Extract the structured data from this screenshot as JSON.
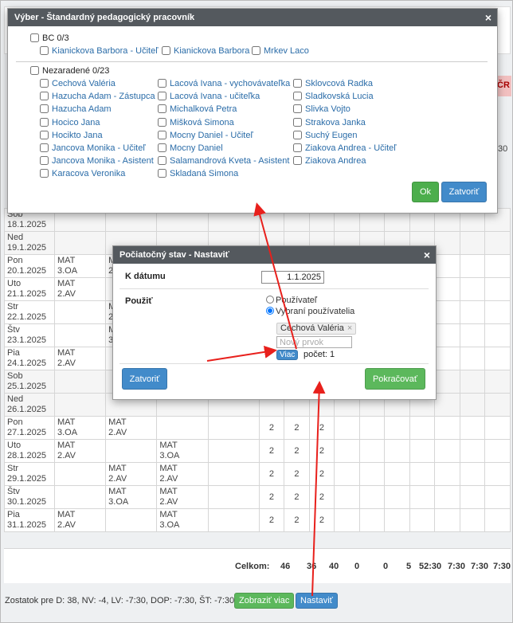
{
  "background": {
    "cr_badge": "ČR",
    "time_tail": ":30",
    "rows": [
      {
        "day": "Sob",
        "date": "18.1.2025",
        "c1": "",
        "c2": "",
        "c3": "",
        "n1": "",
        "n2": "",
        "n3": "",
        "we": true
      },
      {
        "day": "Ned",
        "date": "19.1.2025",
        "c1": "",
        "c2": "",
        "c3": "",
        "n1": "",
        "n2": "",
        "n3": "",
        "we": true
      },
      {
        "day": "Pon",
        "date": "20.1.2025",
        "c1": "MAT\n3.OA",
        "c2": "MAT\n2.AV",
        "c3": "",
        "n1": "",
        "n2": "",
        "n3": "",
        "we": false
      },
      {
        "day": "Uto",
        "date": "21.1.2025",
        "c1": "MAT\n2.AV",
        "c2": "",
        "c3": "",
        "n1": "",
        "n2": "",
        "n3": "",
        "we": false
      },
      {
        "day": "Str",
        "date": "22.1.2025",
        "c1": "",
        "c2": "MAT\n2.AV",
        "c3": "",
        "n1": "",
        "n2": "",
        "n3": "",
        "we": false
      },
      {
        "day": "Štv",
        "date": "23.1.2025",
        "c1": "",
        "c2": "MAT\n3.OA",
        "c3": "",
        "n1": "",
        "n2": "",
        "n3": "",
        "we": false
      },
      {
        "day": "Pia",
        "date": "24.1.2025",
        "c1": "MAT\n2.AV",
        "c2": "",
        "c3": "",
        "n1": "",
        "n2": "",
        "n3": "",
        "we": false
      },
      {
        "day": "Sob",
        "date": "25.1.2025",
        "c1": "",
        "c2": "",
        "c3": "",
        "n1": "",
        "n2": "",
        "n3": "",
        "we": true
      },
      {
        "day": "Ned",
        "date": "26.1.2025",
        "c1": "",
        "c2": "",
        "c3": "",
        "n1": "",
        "n2": "",
        "n3": "",
        "we": true
      },
      {
        "day": "Pon",
        "date": "27.1.2025",
        "c1": "MAT\n3.OA",
        "c2": "MAT\n2.AV",
        "c3": "",
        "n1": "2",
        "n2": "2",
        "n3": "2",
        "we": false
      },
      {
        "day": "Uto",
        "date": "28.1.2025",
        "c1": "MAT\n2.AV",
        "c2": "",
        "c3": "MAT\n3.OA",
        "n1": "2",
        "n2": "2",
        "n3": "2",
        "we": false
      },
      {
        "day": "Str",
        "date": "29.1.2025",
        "c1": "",
        "c2": "MAT\n2.AV",
        "c3": "MAT\n2.AV",
        "n1": "2",
        "n2": "2",
        "n3": "2",
        "we": false
      },
      {
        "day": "Štv",
        "date": "30.1.2025",
        "c1": "",
        "c2": "MAT\n3.OA",
        "c3": "MAT\n2.AV",
        "n1": "2",
        "n2": "2",
        "n3": "2",
        "we": false
      },
      {
        "day": "Pia",
        "date": "31.1.2025",
        "c1": "MAT\n2.AV",
        "c2": "",
        "c3": "MAT\n3.OA",
        "n1": "2",
        "n2": "2",
        "n3": "2",
        "we": false
      }
    ],
    "totals_label": "Celkom:",
    "totals": [
      "46",
      "36",
      "40",
      "0",
      "0",
      "5",
      "52:30",
      "7:30",
      "7:30",
      "7:30"
    ]
  },
  "footer": {
    "text": "Zostatok pre D: 38, NV: -4, LV: -7:30, DOP: -7:30, ŠT: -7:30",
    "show_more": "Zobraziť viac",
    "set": "Nastaviť"
  },
  "selection_modal": {
    "title": "Výber - Štandardný pedagogický pracovník",
    "close_icon": "×",
    "group1": {
      "label": "BC  0/3",
      "items": [
        "Kianickova Barbora - Učiteľ",
        "Kianickova Barbora",
        "Mrkev Laco"
      ]
    },
    "group2": {
      "label": "Nezaradené  0/23",
      "col1": [
        "Cechová Valéria",
        "Hazucha Adam - Zástupca",
        "Hazucha Adam",
        "Hocico Jana",
        "Hocikto Jana",
        "Jancova Monika - Učiteľ",
        "Jancova Monika - Asistent",
        "Karacova Veronika"
      ],
      "col2": [
        "Lacová Ivana - vychovávateľka",
        "Lacová Ivana - učiteľka",
        "Michalková Petra",
        "Mišková Simona",
        "Mocny Daniel - Učiteľ",
        "Mocny Daniel",
        "Salamandrová Kveta - Asistent",
        "Skladaná Simona"
      ],
      "col3": [
        "Sklovcová Radka",
        "Sladkovská Lucia",
        "Slivka Vojto",
        "Strakova Janka",
        "Suchý Eugen",
        "Ziakova Andrea - Učiteľ",
        "Ziakova Andrea"
      ]
    },
    "ok": "Ok",
    "close": "Zatvoriť"
  },
  "init_modal": {
    "title": "Počiatočný stav - Nastaviť",
    "close_icon": "×",
    "date_label": "K dátumu",
    "date_value": "1.1.2025",
    "use_label": "Použiť",
    "radio_user": "Používateľ",
    "radio_selected": "Vybraní používatelia",
    "chip": "Cechová Valéria",
    "chip_remove": "×",
    "new_item_placeholder": "Nový prvok",
    "more": "Viac",
    "count": "počet: 1",
    "close": "Zatvoriť",
    "continue": "Pokračovať"
  },
  "colors": {
    "header": "#54595e",
    "link": "#2a6ca8",
    "green": "#5cb85c",
    "blue": "#428bca",
    "arrow": "#e8201c"
  }
}
